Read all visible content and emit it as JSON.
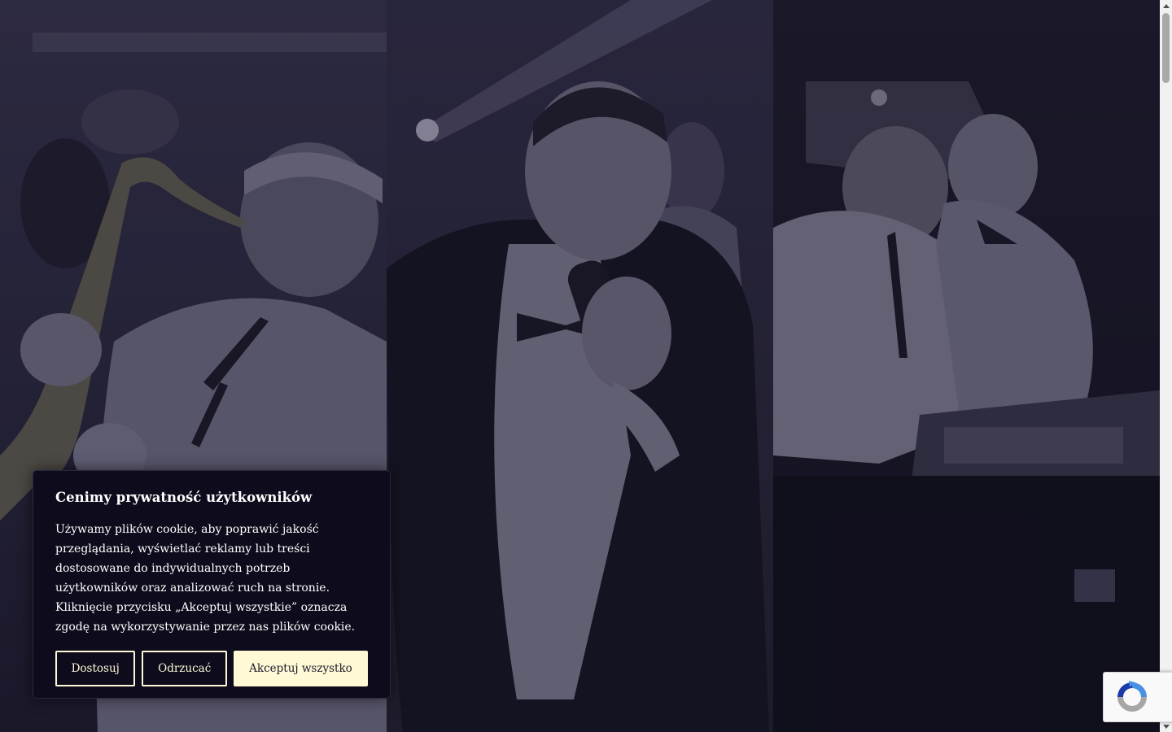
{
  "cookie_banner": {
    "title": "Cenimy prywatność użytkowników",
    "text": "Używamy plików cookie, aby poprawić jakość przeglądania, wyświetlać reklamy lub treści dostosowane do indywidualnych potrzeb użytkowników oraz analizować ruch na stronie. Kliknięcie przycisku „Akceptuj wszystkie” oznacza zgodę na wykorzystywanie przez nas plików cookie.",
    "buttons": {
      "customize": "Dostosuj",
      "reject": "Odrzucać",
      "accept_all": "Akceptuj wszystko"
    }
  },
  "photos": [
    {
      "subject": "saxophonist"
    },
    {
      "subject": "singer-with-microphone"
    },
    {
      "subject": "dj-at-mixer"
    }
  ],
  "icons": {
    "recaptcha": "recaptcha-icon"
  },
  "colors": {
    "banner_background": "#0e0c1c",
    "button_outline": "#fff8d8",
    "accept_button_fill": "#fff9d6"
  }
}
